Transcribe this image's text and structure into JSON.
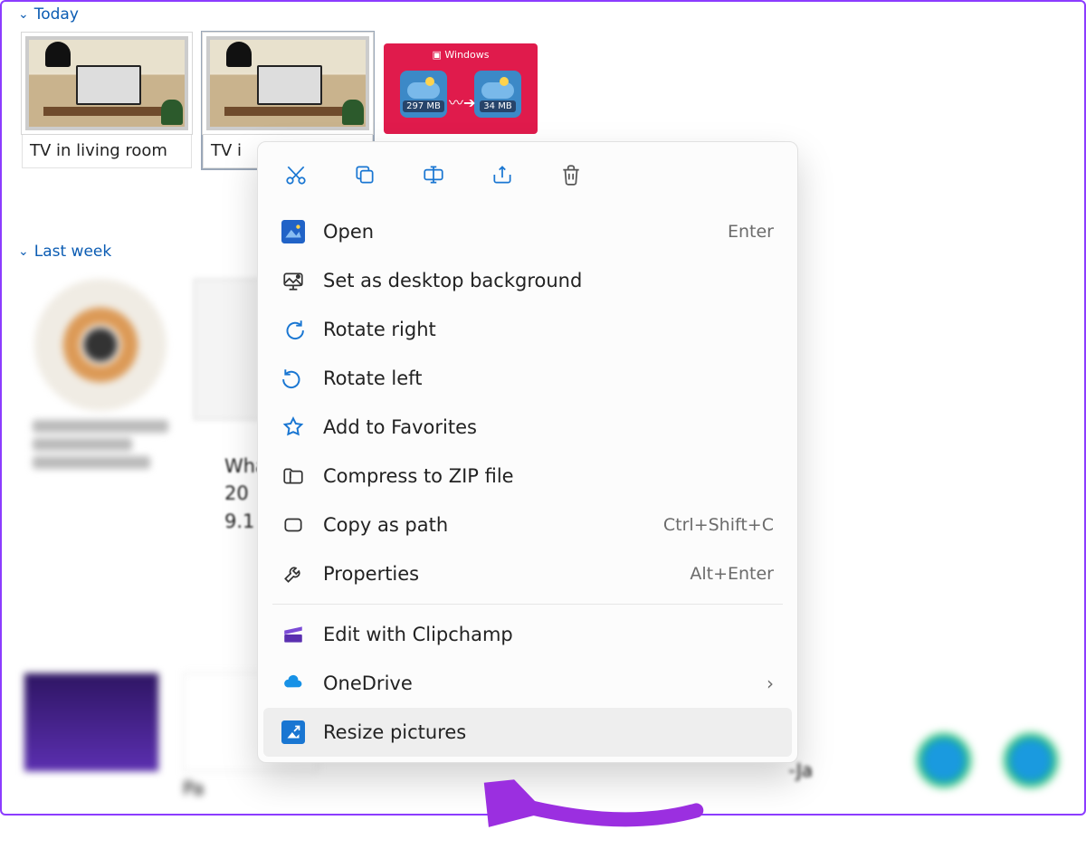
{
  "groups": {
    "today_label": "Today",
    "last_week_label": "Last week"
  },
  "tiles": {
    "tv1_caption": "TV in living room",
    "tv2_caption": "TV i",
    "poster_title": "Windows",
    "poster_badge_left": "297 MB",
    "poster_badge_right": "34 MB"
  },
  "doc_side": {
    "l1": "Wha",
    "l2": "20",
    "l3": "9.1"
  },
  "bottom_caption": "Pa",
  "bottom_date_fragment": "-Ja",
  "context_menu": {
    "open": "Open",
    "open_shortcut": "Enter",
    "set_bg": "Set as desktop background",
    "rotate_right": "Rotate right",
    "rotate_left": "Rotate left",
    "add_fav": "Add to Favorites",
    "compress": "Compress to ZIP file",
    "copy_path": "Copy as path",
    "copy_path_shortcut": "Ctrl+Shift+C",
    "properties": "Properties",
    "properties_shortcut": "Alt+Enter",
    "clipchamp": "Edit with Clipchamp",
    "onedrive": "OneDrive",
    "resize": "Resize pictures"
  }
}
